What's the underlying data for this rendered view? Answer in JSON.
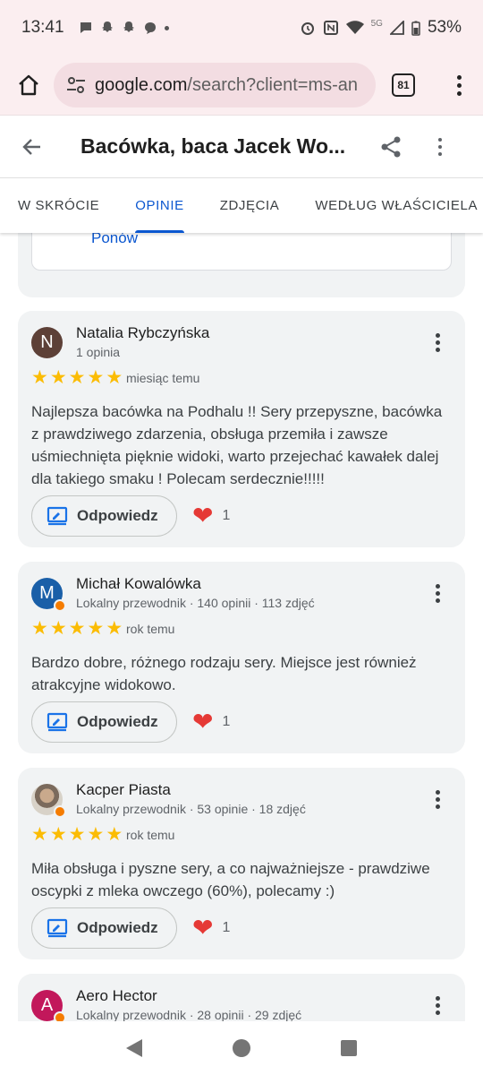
{
  "status_bar": {
    "time": "13:41",
    "network": "5G",
    "battery": "53%",
    "icons": [
      "chat-bubble-icon",
      "snapchat-icon",
      "snapchat-icon",
      "messenger-icon",
      "alarm-icon",
      "nfc-icon",
      "wifi-icon",
      "signal-icon",
      "battery-icon"
    ]
  },
  "browser": {
    "url_host": "google.com",
    "url_path": "/search?client=ms-an",
    "tab_count": "81"
  },
  "place": {
    "title": "Bacówka, baca Jacek Wo..."
  },
  "tabs": [
    {
      "label": "W SKRÓCIE"
    },
    {
      "label": "OPINIE"
    },
    {
      "label": "ZDJĘCIA"
    },
    {
      "label": "WEDŁUG WŁAŚCICIELA"
    }
  ],
  "retry": {
    "label": "Ponów"
  },
  "reviews": [
    {
      "initial": "N",
      "avatar_color": "#5d4037",
      "author": "Natalia Rybczyńska",
      "meta": "1 opinia",
      "rating": 5,
      "when": "miesiąc temu",
      "text": "Najlepsza bacówka na Podhalu !! Sery przepyszne, bacówka z prawdziwego zdarzenia, obsługa przemiła i zawsze uśmiechnięta pięknie widoki, warto przejechać kawałek dalej dla takiego smaku ! Polecam serdecznie!!!!!",
      "reply_label": "Odpowiedz",
      "likes": "1"
    },
    {
      "initial": "M",
      "avatar_color": "#1a5fa8",
      "author": "Michał Kowalówka",
      "meta": "Lokalny przewodnik · 140 opinii · 113 zdjęć",
      "rating": 5,
      "when": "rok temu",
      "text": "Bardzo dobre, różnego rodzaju sery. Miejsce jest również atrakcyjne widokowo.",
      "reply_label": "Odpowiedz",
      "likes": "1"
    },
    {
      "initial": "",
      "avatar_color": "#8d7b6b",
      "author": "Kacper Piasta",
      "meta": "Lokalny przewodnik · 53 opinie · 18 zdjęć",
      "rating": 5,
      "when": "rok temu",
      "text": "Miła obsługa i pyszne sery, a co najważniejsze - prawdziwe oscypki z mleka owczego (60%), polecamy :)",
      "reply_label": "Odpowiedz",
      "likes": "1"
    },
    {
      "initial": "A",
      "avatar_color": "#c2185b",
      "author": "Aero Hector",
      "meta": "Lokalny przewodnik · 28 opinii · 29 zdjęć"
    }
  ],
  "colors": {
    "accent": "#0b57d0",
    "star": "#fbbc04",
    "heart": "#e53935",
    "card_bg": "#f1f3f4",
    "chrome_bg": "#fbeef0"
  }
}
